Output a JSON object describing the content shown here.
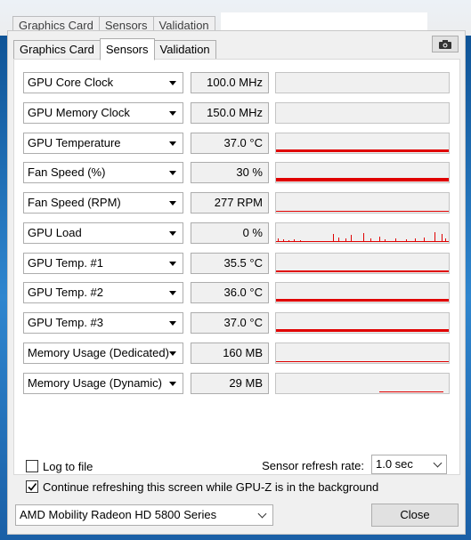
{
  "background_window": {
    "tabs": [
      "Graphics Card",
      "Sensors",
      "Validation"
    ]
  },
  "tabs": [
    {
      "label": "Graphics Card",
      "active": false
    },
    {
      "label": "Sensors",
      "active": true
    },
    {
      "label": "Validation",
      "active": false
    }
  ],
  "toolbar": {
    "camera_icon": "camera-icon"
  },
  "colors": {
    "graph_line": "#e00000",
    "graph_bg": "#f0f0f0"
  },
  "sensors": [
    {
      "name": "GPU Core Clock",
      "value": "100.0 MHz",
      "graph": {
        "type": "none"
      }
    },
    {
      "name": "GPU Memory Clock",
      "value": "150.0 MHz",
      "graph": {
        "type": "none"
      }
    },
    {
      "name": "GPU Temperature",
      "value": "37.0 °C",
      "graph": {
        "type": "flat",
        "level": 0.22
      }
    },
    {
      "name": "Fan Speed (%)",
      "value": "30 %",
      "graph": {
        "type": "flat",
        "level": 0.3
      }
    },
    {
      "name": "Fan Speed (RPM)",
      "value": "277 RPM",
      "graph": {
        "type": "flat",
        "level": 0.05
      }
    },
    {
      "name": "GPU Load",
      "value": "0 %",
      "graph": {
        "type": "spiky"
      }
    },
    {
      "name": "GPU Temp. #1",
      "value": "35.5 °C",
      "graph": {
        "type": "flat",
        "level": 0.2
      }
    },
    {
      "name": "GPU Temp. #2",
      "value": "36.0 °C",
      "graph": {
        "type": "flat",
        "level": 0.21
      }
    },
    {
      "name": "GPU Temp. #3",
      "value": "37.0 °C",
      "graph": {
        "type": "flat",
        "level": 0.22
      }
    },
    {
      "name": "Memory Usage (Dedicated)",
      "value": "160 MB",
      "graph": {
        "type": "flat",
        "level": 0.08
      }
    },
    {
      "name": "Memory Usage (Dynamic)",
      "value": "29 MB",
      "graph": {
        "type": "partial",
        "level": 0.08
      }
    }
  ],
  "options": {
    "log_to_file": {
      "label": "Log to file",
      "checked": false
    },
    "continue_refresh": {
      "label": "Continue refreshing this screen while GPU-Z is in the background",
      "checked": true
    }
  },
  "refresh": {
    "label": "Sensor refresh rate:",
    "value": "1.0 sec"
  },
  "device": {
    "selected": "AMD Mobility Radeon HD 5800 Series"
  },
  "close_button": {
    "label": "Close"
  }
}
